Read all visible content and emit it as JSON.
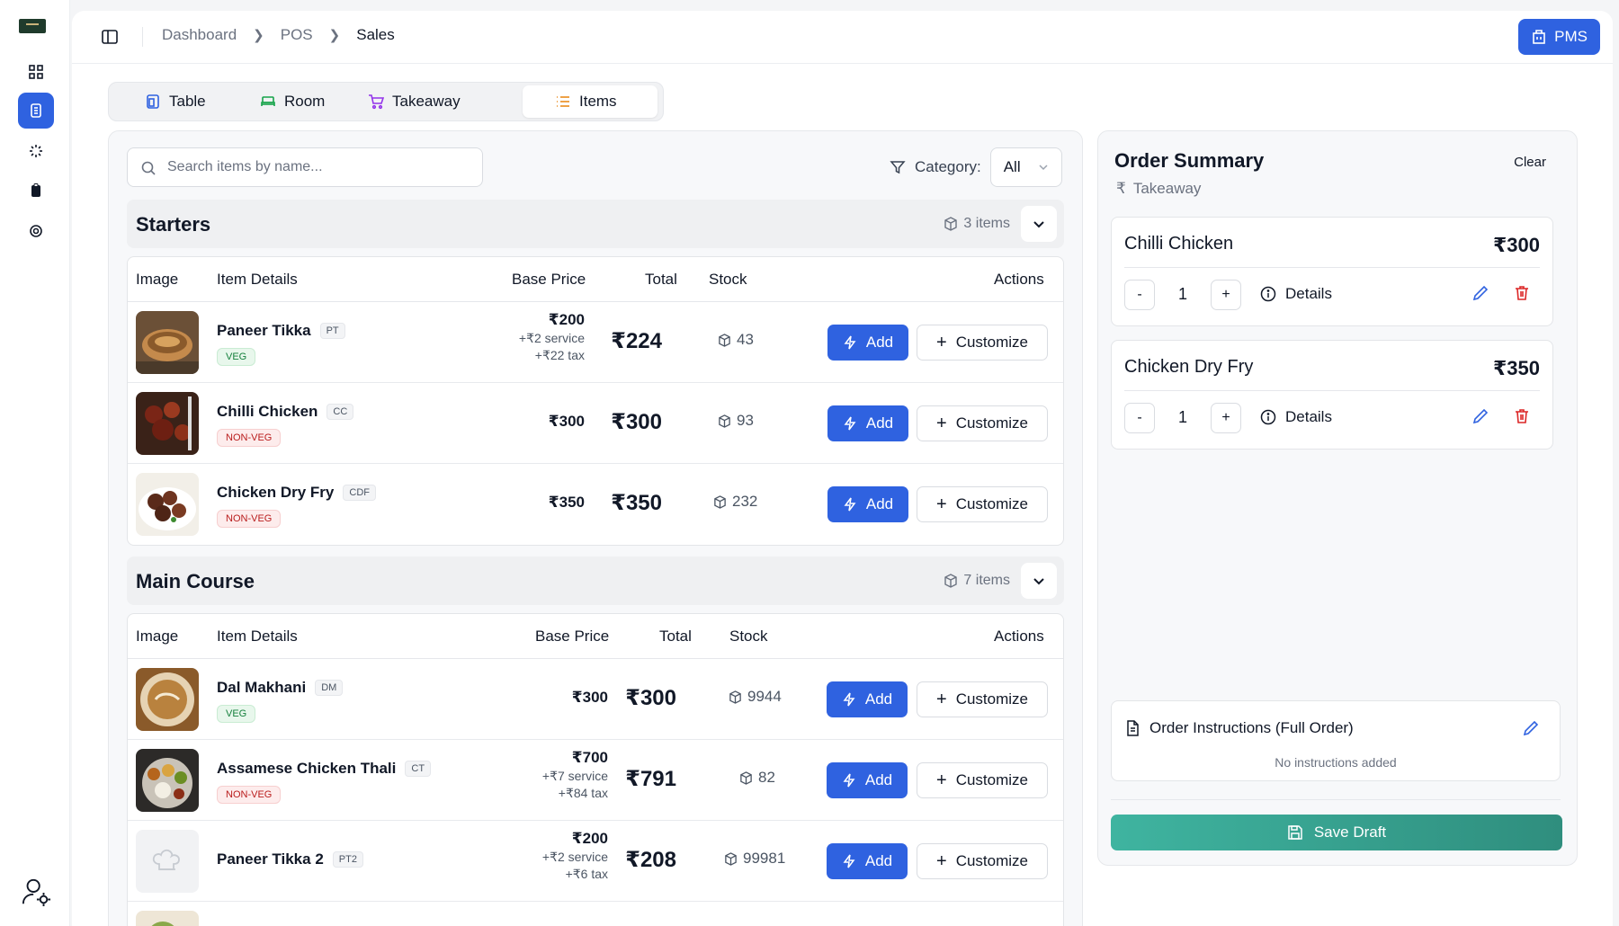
{
  "breadcrumb": {
    "items": [
      "Dashboard",
      "POS",
      "Sales"
    ]
  },
  "header": {
    "pms_label": "PMS"
  },
  "tabs": [
    {
      "label": "Table"
    },
    {
      "label": "Room"
    },
    {
      "label": "Takeaway"
    },
    {
      "label": "Items"
    }
  ],
  "search": {
    "placeholder": "Search items by name..."
  },
  "category": {
    "label": "Category:",
    "value": "All"
  },
  "columns": {
    "image": "Image",
    "details": "Item Details",
    "base": "Base Price",
    "total": "Total",
    "stock": "Stock",
    "actions": "Actions"
  },
  "actions": {
    "add": "Add",
    "customize": "Customize"
  },
  "starters": {
    "title": "Starters",
    "count": "3 items",
    "items": [
      {
        "name": "Paneer Tikka",
        "code": "PT",
        "tag": "VEG",
        "base": "₹200",
        "service": "+₹2 service",
        "tax": "+₹22 tax",
        "total": "₹224",
        "stock": "43"
      },
      {
        "name": "Chilli Chicken",
        "code": "CC",
        "tag": "NON-VEG",
        "base": "₹300",
        "total": "₹300",
        "stock": "93"
      },
      {
        "name": "Chicken Dry Fry",
        "code": "CDF",
        "tag": "NON-VEG",
        "base": "₹350",
        "total": "₹350",
        "stock": "232"
      }
    ]
  },
  "main_course": {
    "title": "Main Course",
    "count": "7 items",
    "items": [
      {
        "name": "Dal Makhani",
        "code": "DM",
        "tag": "VEG",
        "base": "₹300",
        "total": "₹300",
        "stock": "9944"
      },
      {
        "name": "Assamese Chicken Thali",
        "code": "CT",
        "tag": "NON-VEG",
        "base": "₹700",
        "service": "+₹7 service",
        "tax": "+₹84 tax",
        "total": "₹791",
        "stock": "82"
      },
      {
        "name": "Paneer Tikka 2",
        "code": "PT2",
        "base": "₹200",
        "service": "+₹2 service",
        "tax": "+₹6 tax",
        "total": "₹208",
        "stock": "99981"
      }
    ]
  },
  "order": {
    "title": "Order Summary",
    "clear": "Clear",
    "type": "Takeaway",
    "items": [
      {
        "name": "Chilli Chicken",
        "price": "₹300",
        "qty": "1",
        "minus": "-",
        "plus": "+",
        "details": "Details"
      },
      {
        "name": "Chicken Dry Fry",
        "price": "₹350",
        "qty": "1",
        "minus": "-",
        "plus": "+",
        "details": "Details"
      }
    ],
    "instructions_title": "Order Instructions (Full Order)",
    "instructions_empty": "No instructions added",
    "save": "Save Draft"
  },
  "colors": {
    "primary": "#2f62e0",
    "save": "#3aa894",
    "veg": "#15803d",
    "nonveg": "#b91c1c"
  }
}
